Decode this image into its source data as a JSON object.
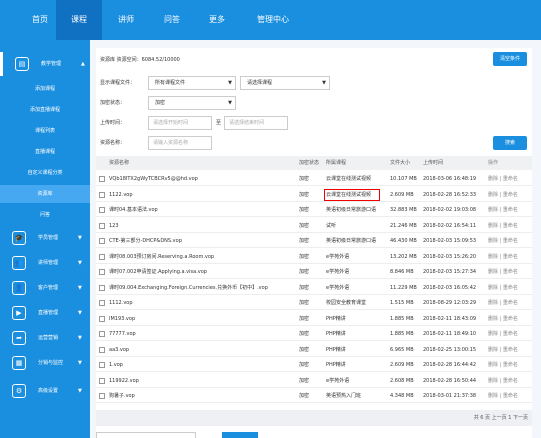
{
  "topnav": {
    "items": [
      "首页",
      "课程",
      "讲师",
      "问答",
      "更多",
      "管理中心"
    ]
  },
  "sidebar": {
    "groups": [
      {
        "label": "教学管理",
        "icon": "book-icon",
        "glyph": "▤"
      },
      {
        "label": "学员管理",
        "icon": "graduate-icon",
        "glyph": "🎓"
      },
      {
        "label": "讲师管理",
        "icon": "teacher-icon",
        "glyph": "👥"
      },
      {
        "label": "客户管理",
        "icon": "user-icon",
        "glyph": "👤"
      },
      {
        "label": "直播管理",
        "icon": "play-icon",
        "glyph": "▶"
      },
      {
        "label": "运营营销",
        "icon": "share-icon",
        "glyph": "➦"
      },
      {
        "label": "分销与监控",
        "icon": "chart-icon",
        "glyph": "▦"
      },
      {
        "label": "高级设置",
        "icon": "gear-icon",
        "glyph": "⚙"
      }
    ],
    "subitems": [
      "添加课程",
      "添加直播课程",
      "课程列表",
      "直播课程",
      "自定义课程分类",
      "资源库",
      "问答"
    ]
  },
  "main": {
    "storage": "资源库   资源空间：6084.52/10000",
    "clear_button": "清空条件",
    "filters": {
      "course_category_label": "显示课程文件：",
      "course_category_value": "所有课程文件",
      "course_select_placeholder": "请选择课程",
      "status_label": "加密状态：",
      "status_value": "加密",
      "upload_time_label": "上传时间：",
      "start_placeholder": "请选择开始时间",
      "to": "至",
      "end_placeholder": "请选择结束时间",
      "resource_name_label": "资源名称：",
      "resource_name_placeholder": "请输入资源名称",
      "search_button": "搜索"
    },
    "table": {
      "headers": [
        "资源名称",
        "加密状态",
        "所属课程",
        "文件大小",
        "上传时间",
        "操作"
      ],
      "rows": [
        {
          "name": "VQb18ITX2gWyTCBCRv5@@hd.vop",
          "status": "加密",
          "course": "云课堂在线测试视频",
          "size": "10.107 MB",
          "time": "2018-03-06 16:48:19",
          "ops": "删除 | 重命名"
        },
        {
          "name": "1122.vop",
          "status": "加密",
          "course": "云课堂在线测试视频",
          "size": "2.609 MB",
          "time": "2018-02-28 16:52:33",
          "ops": "删除 | 重命名"
        },
        {
          "name": "课时04.基本语法.vop",
          "status": "加密",
          "course": "英语初级日常旅游口语",
          "size": "32.883 MB",
          "time": "2018-02-02 19:03:08",
          "ops": "删除 | 重命名"
        },
        {
          "name": "123",
          "status": "加密",
          "course": "试听",
          "size": "21.246 MB",
          "time": "2018-02-02 16:54:11",
          "ops": "删除 | 重命名"
        },
        {
          "name": "CTE-第三部分-DHCP&DNS.vop",
          "status": "加密",
          "course": "英语初级日常旅游口语",
          "size": "46.430 MB",
          "time": "2018-02-03 15:09:53",
          "ops": "删除 | 重命名"
        },
        {
          "name": "课时08.003预订房间.Reserving.a.Room.vop",
          "status": "加密",
          "course": "e学苑外语",
          "size": "13.202 MB",
          "time": "2018-02-03 15:26:20",
          "ops": "删除 | 重命名"
        },
        {
          "name": "课时07.002申请签证.Applying.a.visa.vop",
          "status": "加密",
          "course": "e学苑外语",
          "size": "8.846 MB",
          "time": "2018-02-03 15:27:34",
          "ops": "删除 | 重命名"
        },
        {
          "name": "课时09.004.Exchanging.Foreign.Currencies.兑换外币【初中】.vop",
          "status": "加密",
          "course": "e学苑外语",
          "size": "11.229 MB",
          "time": "2018-02-03 16:05:42",
          "ops": "删除 | 重命名"
        },
        {
          "name": "1112.vop",
          "status": "加密",
          "course": "校园安全教育课堂",
          "size": "1.515 MB",
          "time": "2018-08-29 12:03:29",
          "ops": "删除 | 重命名"
        },
        {
          "name": "IM193.vop",
          "status": "加密",
          "course": "PHP精讲",
          "size": "1.885 MB",
          "time": "2018-02-11 18:43:09",
          "ops": "删除 | 重命名"
        },
        {
          "name": "77777.vop",
          "status": "加密",
          "course": "PHP精讲",
          "size": "1.885 MB",
          "time": "2018-02-11 18:49:10",
          "ops": "删除 | 重命名"
        },
        {
          "name": "aa3.vop",
          "status": "加密",
          "course": "PHP精讲",
          "size": "6.965 MB",
          "time": "2018-02-25 13:00:15",
          "ops": "删除 | 重命名"
        },
        {
          "name": "1.vop",
          "status": "加密",
          "course": "PHP精讲",
          "size": "2.609 MB",
          "time": "2018-02-28 16:44:42",
          "ops": "删除 | 重命名"
        },
        {
          "name": "119922.vop",
          "status": "加密",
          "course": "e学苑外语",
          "size": "2.608 MB",
          "time": "2018-02-28 16:50:44",
          "ops": "删除 | 重命名"
        },
        {
          "name": "狗暑子.vop",
          "status": "加密",
          "course": "英语预热入门班",
          "size": "4.348 MB",
          "time": "2018-03-01 21:37:38",
          "ops": "删除 | 重命名"
        }
      ]
    },
    "pager": "共 6 页   上一页   1   下一页"
  }
}
